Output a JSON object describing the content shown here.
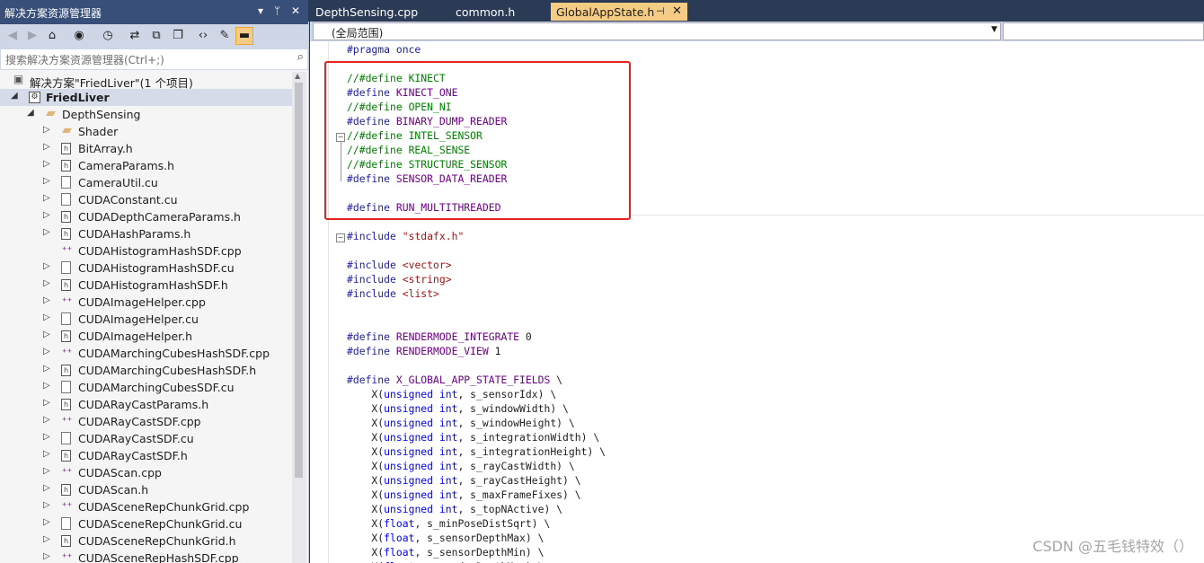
{
  "solution_explorer": {
    "title": "解决方案资源管理器",
    "title_controls": [
      "▾",
      "ᛘ",
      "✕"
    ],
    "search_placeholder": "搜索解决方案资源管理器(Ctrl+;)",
    "solution_label": "解决方案\"FriedLiver\"(1 个项目)",
    "project_label": "FriedLiver",
    "folder_label": "DepthSensing",
    "files": [
      {
        "name": "Shader",
        "kind": "folder",
        "expander": true
      },
      {
        "name": "BitArray.h",
        "kind": "h",
        "expander": true
      },
      {
        "name": "CameraParams.h",
        "kind": "h",
        "expander": true
      },
      {
        "name": "CameraUtil.cu",
        "kind": "cu",
        "expander": true
      },
      {
        "name": "CUDAConstant.cu",
        "kind": "cu",
        "expander": true
      },
      {
        "name": "CUDADepthCameraParams.h",
        "kind": "h",
        "expander": true
      },
      {
        "name": "CUDAHashParams.h",
        "kind": "h",
        "expander": true
      },
      {
        "name": "CUDAHistogramHashSDF.cpp",
        "kind": "cpp",
        "expander": false
      },
      {
        "name": "CUDAHistogramHashSDF.cu",
        "kind": "cu",
        "expander": true
      },
      {
        "name": "CUDAHistogramHashSDF.h",
        "kind": "h",
        "expander": true
      },
      {
        "name": "CUDAImageHelper.cpp",
        "kind": "cpp",
        "expander": true
      },
      {
        "name": "CUDAImageHelper.cu",
        "kind": "cu",
        "expander": true
      },
      {
        "name": "CUDAImageHelper.h",
        "kind": "h",
        "expander": true
      },
      {
        "name": "CUDAMarchingCubesHashSDF.cpp",
        "kind": "cpp",
        "expander": true
      },
      {
        "name": "CUDAMarchingCubesHashSDF.h",
        "kind": "h",
        "expander": true
      },
      {
        "name": "CUDAMarchingCubesSDF.cu",
        "kind": "cu",
        "expander": true
      },
      {
        "name": "CUDARayCastParams.h",
        "kind": "h",
        "expander": true
      },
      {
        "name": "CUDARayCastSDF.cpp",
        "kind": "cpp",
        "expander": true
      },
      {
        "name": "CUDARayCastSDF.cu",
        "kind": "cu",
        "expander": true
      },
      {
        "name": "CUDARayCastSDF.h",
        "kind": "h",
        "expander": true
      },
      {
        "name": "CUDAScan.cpp",
        "kind": "cpp",
        "expander": true
      },
      {
        "name": "CUDAScan.h",
        "kind": "h",
        "expander": true
      },
      {
        "name": "CUDASceneRepChunkGrid.cpp",
        "kind": "cpp",
        "expander": true
      },
      {
        "name": "CUDASceneRepChunkGrid.cu",
        "kind": "cu",
        "expander": true
      },
      {
        "name": "CUDASceneRepChunkGrid.h",
        "kind": "h",
        "expander": true
      },
      {
        "name": "CUDASceneRepHashSDF.cpp",
        "kind": "cpp",
        "expander": true
      }
    ]
  },
  "editor": {
    "tabs": [
      {
        "label": "DepthSensing.cpp",
        "active": false
      },
      {
        "label": "common.h",
        "active": false
      },
      {
        "label": "GlobalAppState.h",
        "active": true
      }
    ],
    "active_tab_pin": "⊣",
    "active_tab_close": "✕",
    "scope_dropdown": "(全局范围)",
    "code_lines": [
      [
        [
          "pp",
          "#pragma once"
        ]
      ],
      [],
      [
        [
          "cm",
          "//#define KINECT"
        ]
      ],
      [
        [
          "pp",
          "#define "
        ],
        [
          "mac",
          "KINECT_ONE"
        ]
      ],
      [
        [
          "cm",
          "//#define OPEN_NI"
        ]
      ],
      [
        [
          "pp",
          "#define "
        ],
        [
          "mac",
          "BINARY_DUMP_READER"
        ]
      ],
      [
        [
          "cm",
          "//#define INTEL_SENSOR"
        ]
      ],
      [
        [
          "cm",
          "//#define REAL_SENSE"
        ]
      ],
      [
        [
          "cm",
          "//#define STRUCTURE_SENSOR"
        ]
      ],
      [
        [
          "pp",
          "#define "
        ],
        [
          "mac",
          "SENSOR_DATA_READER"
        ]
      ],
      [],
      [
        [
          "pp",
          "#define "
        ],
        [
          "mac",
          "RUN_MULTITHREADED"
        ]
      ],
      [],
      [
        [
          "pp",
          "#include "
        ],
        [
          "str",
          "\"stdafx.h\""
        ]
      ],
      [],
      [
        [
          "pp",
          "#include "
        ],
        [
          "str",
          "<vector>"
        ]
      ],
      [
        [
          "pp",
          "#include "
        ],
        [
          "str",
          "<string>"
        ]
      ],
      [
        [
          "pp",
          "#include "
        ],
        [
          "str",
          "<list>"
        ]
      ],
      [],
      [],
      [
        [
          "pp",
          "#define "
        ],
        [
          "mac",
          "RENDERMODE_INTEGRATE"
        ],
        [
          "pl",
          " 0"
        ]
      ],
      [
        [
          "pp",
          "#define "
        ],
        [
          "mac",
          "RENDERMODE_VIEW"
        ],
        [
          "pl",
          " 1"
        ]
      ],
      [],
      [
        [
          "pp",
          "#define "
        ],
        [
          "mac",
          "X_GLOBAL_APP_STATE_FIELDS"
        ],
        [
          "pl",
          " \\"
        ]
      ],
      [
        [
          "pl",
          "    X("
        ],
        [
          "kw",
          "unsigned int"
        ],
        [
          "pl",
          ", s_sensorIdx) \\"
        ]
      ],
      [
        [
          "pl",
          "    X("
        ],
        [
          "kw",
          "unsigned int"
        ],
        [
          "pl",
          ", s_windowWidth) \\"
        ]
      ],
      [
        [
          "pl",
          "    X("
        ],
        [
          "kw",
          "unsigned int"
        ],
        [
          "pl",
          ", s_windowHeight) \\"
        ]
      ],
      [
        [
          "pl",
          "    X("
        ],
        [
          "kw",
          "unsigned int"
        ],
        [
          "pl",
          ", s_integrationWidth) \\"
        ]
      ],
      [
        [
          "pl",
          "    X("
        ],
        [
          "kw",
          "unsigned int"
        ],
        [
          "pl",
          ", s_integrationHeight) \\"
        ]
      ],
      [
        [
          "pl",
          "    X("
        ],
        [
          "kw",
          "unsigned int"
        ],
        [
          "pl",
          ", s_rayCastWidth) \\"
        ]
      ],
      [
        [
          "pl",
          "    X("
        ],
        [
          "kw",
          "unsigned int"
        ],
        [
          "pl",
          ", s_rayCastHeight) \\"
        ]
      ],
      [
        [
          "pl",
          "    X("
        ],
        [
          "kw",
          "unsigned int"
        ],
        [
          "pl",
          ", s_maxFrameFixes) \\"
        ]
      ],
      [
        [
          "pl",
          "    X("
        ],
        [
          "kw",
          "unsigned int"
        ],
        [
          "pl",
          ", s_topNActive) \\"
        ]
      ],
      [
        [
          "pl",
          "    X("
        ],
        [
          "kw",
          "float"
        ],
        [
          "pl",
          ", s_minPoseDistSqrt) \\"
        ]
      ],
      [
        [
          "pl",
          "    X("
        ],
        [
          "kw",
          "float"
        ],
        [
          "pl",
          ", s_sensorDepthMax) \\"
        ]
      ],
      [
        [
          "pl",
          "    X("
        ],
        [
          "kw",
          "float"
        ],
        [
          "pl",
          ", s_sensorDepthMin) \\"
        ]
      ],
      [
        [
          "pl",
          "    X("
        ],
        [
          "kw",
          "float"
        ],
        [
          "pl",
          ", s_renderDepthMax) \\"
        ]
      ]
    ]
  },
  "watermark": "CSDN @五毛钱特效（）",
  "colors": {
    "highlight_box": "#e8201f",
    "title_bar": "#384f7a",
    "active_tab": "#f5cc84"
  }
}
